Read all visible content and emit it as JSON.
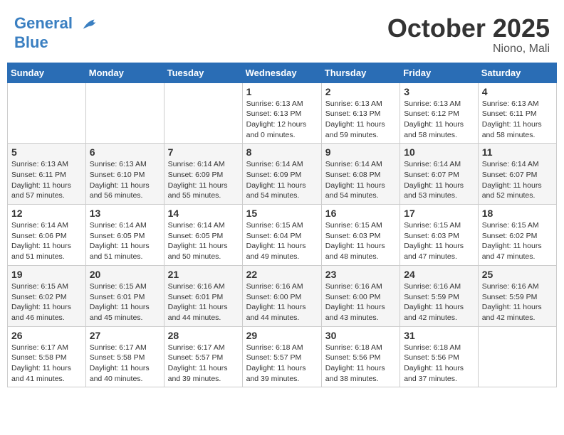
{
  "header": {
    "logo_line1": "General",
    "logo_line2": "Blue",
    "month": "October 2025",
    "location": "Niono, Mali"
  },
  "days_of_week": [
    "Sunday",
    "Monday",
    "Tuesday",
    "Wednesday",
    "Thursday",
    "Friday",
    "Saturday"
  ],
  "weeks": [
    [
      {
        "day": "",
        "info": ""
      },
      {
        "day": "",
        "info": ""
      },
      {
        "day": "",
        "info": ""
      },
      {
        "day": "1",
        "info": "Sunrise: 6:13 AM\nSunset: 6:13 PM\nDaylight: 12 hours and 0 minutes."
      },
      {
        "day": "2",
        "info": "Sunrise: 6:13 AM\nSunset: 6:13 PM\nDaylight: 11 hours and 59 minutes."
      },
      {
        "day": "3",
        "info": "Sunrise: 6:13 AM\nSunset: 6:12 PM\nDaylight: 11 hours and 58 minutes."
      },
      {
        "day": "4",
        "info": "Sunrise: 6:13 AM\nSunset: 6:11 PM\nDaylight: 11 hours and 58 minutes."
      }
    ],
    [
      {
        "day": "5",
        "info": "Sunrise: 6:13 AM\nSunset: 6:11 PM\nDaylight: 11 hours and 57 minutes."
      },
      {
        "day": "6",
        "info": "Sunrise: 6:13 AM\nSunset: 6:10 PM\nDaylight: 11 hours and 56 minutes."
      },
      {
        "day": "7",
        "info": "Sunrise: 6:14 AM\nSunset: 6:09 PM\nDaylight: 11 hours and 55 minutes."
      },
      {
        "day": "8",
        "info": "Sunrise: 6:14 AM\nSunset: 6:09 PM\nDaylight: 11 hours and 54 minutes."
      },
      {
        "day": "9",
        "info": "Sunrise: 6:14 AM\nSunset: 6:08 PM\nDaylight: 11 hours and 54 minutes."
      },
      {
        "day": "10",
        "info": "Sunrise: 6:14 AM\nSunset: 6:07 PM\nDaylight: 11 hours and 53 minutes."
      },
      {
        "day": "11",
        "info": "Sunrise: 6:14 AM\nSunset: 6:07 PM\nDaylight: 11 hours and 52 minutes."
      }
    ],
    [
      {
        "day": "12",
        "info": "Sunrise: 6:14 AM\nSunset: 6:06 PM\nDaylight: 11 hours and 51 minutes."
      },
      {
        "day": "13",
        "info": "Sunrise: 6:14 AM\nSunset: 6:05 PM\nDaylight: 11 hours and 51 minutes."
      },
      {
        "day": "14",
        "info": "Sunrise: 6:14 AM\nSunset: 6:05 PM\nDaylight: 11 hours and 50 minutes."
      },
      {
        "day": "15",
        "info": "Sunrise: 6:15 AM\nSunset: 6:04 PM\nDaylight: 11 hours and 49 minutes."
      },
      {
        "day": "16",
        "info": "Sunrise: 6:15 AM\nSunset: 6:03 PM\nDaylight: 11 hours and 48 minutes."
      },
      {
        "day": "17",
        "info": "Sunrise: 6:15 AM\nSunset: 6:03 PM\nDaylight: 11 hours and 47 minutes."
      },
      {
        "day": "18",
        "info": "Sunrise: 6:15 AM\nSunset: 6:02 PM\nDaylight: 11 hours and 47 minutes."
      }
    ],
    [
      {
        "day": "19",
        "info": "Sunrise: 6:15 AM\nSunset: 6:02 PM\nDaylight: 11 hours and 46 minutes."
      },
      {
        "day": "20",
        "info": "Sunrise: 6:15 AM\nSunset: 6:01 PM\nDaylight: 11 hours and 45 minutes."
      },
      {
        "day": "21",
        "info": "Sunrise: 6:16 AM\nSunset: 6:01 PM\nDaylight: 11 hours and 44 minutes."
      },
      {
        "day": "22",
        "info": "Sunrise: 6:16 AM\nSunset: 6:00 PM\nDaylight: 11 hours and 44 minutes."
      },
      {
        "day": "23",
        "info": "Sunrise: 6:16 AM\nSunset: 6:00 PM\nDaylight: 11 hours and 43 minutes."
      },
      {
        "day": "24",
        "info": "Sunrise: 6:16 AM\nSunset: 5:59 PM\nDaylight: 11 hours and 42 minutes."
      },
      {
        "day": "25",
        "info": "Sunrise: 6:16 AM\nSunset: 5:59 PM\nDaylight: 11 hours and 42 minutes."
      }
    ],
    [
      {
        "day": "26",
        "info": "Sunrise: 6:17 AM\nSunset: 5:58 PM\nDaylight: 11 hours and 41 minutes."
      },
      {
        "day": "27",
        "info": "Sunrise: 6:17 AM\nSunset: 5:58 PM\nDaylight: 11 hours and 40 minutes."
      },
      {
        "day": "28",
        "info": "Sunrise: 6:17 AM\nSunset: 5:57 PM\nDaylight: 11 hours and 39 minutes."
      },
      {
        "day": "29",
        "info": "Sunrise: 6:18 AM\nSunset: 5:57 PM\nDaylight: 11 hours and 39 minutes."
      },
      {
        "day": "30",
        "info": "Sunrise: 6:18 AM\nSunset: 5:56 PM\nDaylight: 11 hours and 38 minutes."
      },
      {
        "day": "31",
        "info": "Sunrise: 6:18 AM\nSunset: 5:56 PM\nDaylight: 11 hours and 37 minutes."
      },
      {
        "day": "",
        "info": ""
      }
    ]
  ]
}
